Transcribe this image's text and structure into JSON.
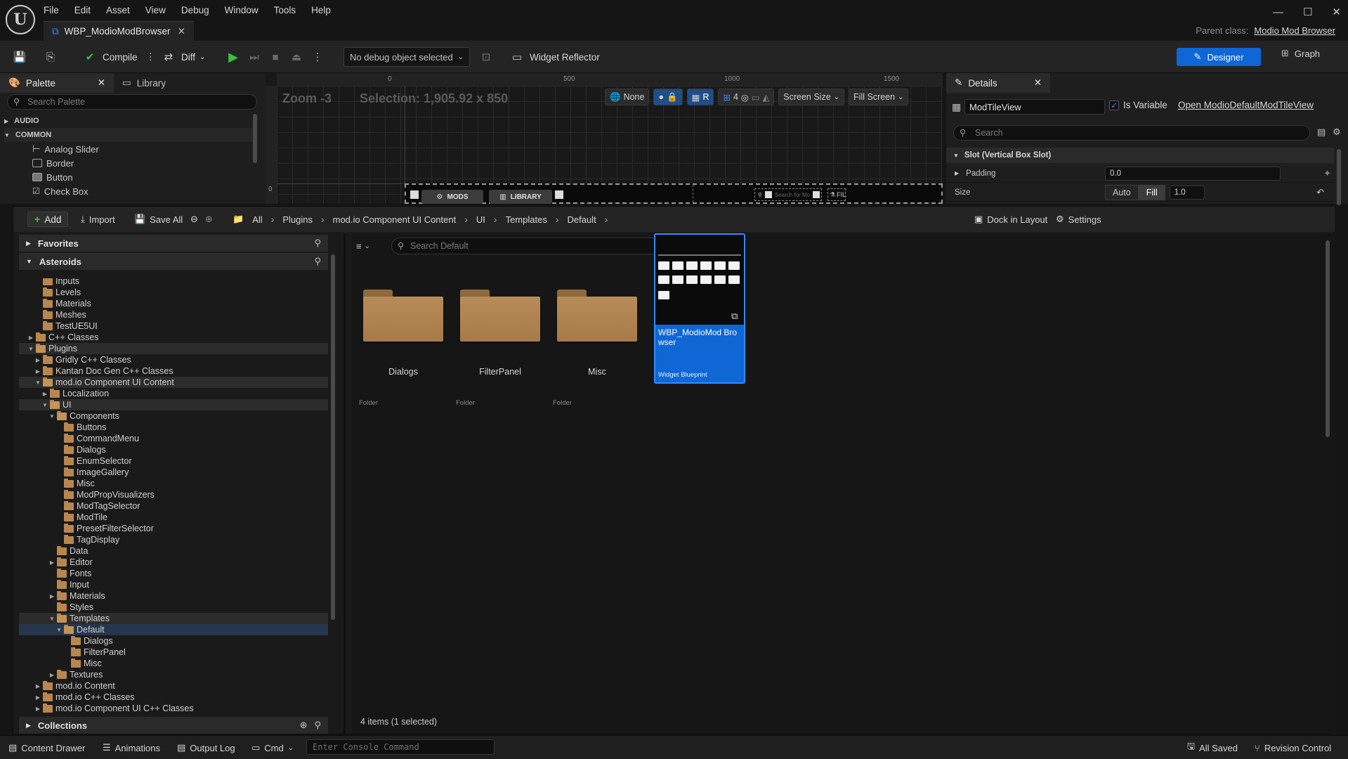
{
  "app": {
    "menu": [
      "File",
      "Edit",
      "Asset",
      "View",
      "Debug",
      "Window",
      "Tools",
      "Help"
    ],
    "document_tab": "WBP_ModioModBrowser",
    "parent_class_label": "Parent class:",
    "parent_class_value": "Modio Mod Browser"
  },
  "toolbar": {
    "compile": "Compile",
    "diff": "Diff",
    "debug_object": "No debug object selected",
    "widget_reflector": "Widget Reflector",
    "designer": "Designer",
    "graph": "Graph"
  },
  "palette": {
    "tab": "Palette",
    "library_tab": "Library",
    "search_placeholder": "Search Palette",
    "categories": [
      "AUDIO",
      "COMMON"
    ],
    "items": [
      "Analog Slider",
      "Border",
      "Button",
      "Check Box"
    ]
  },
  "canvas": {
    "zoom": "Zoom -3",
    "selection": "Selection: 1,905.92 x 850",
    "ruler_marks": [
      "0",
      "500",
      "1000",
      "1500"
    ],
    "ruler_v_mark": "0",
    "none_label": "None",
    "r_label": "R",
    "grid_count": "4",
    "screen_size": "Screen Size",
    "fill_screen": "Fill Screen",
    "preview_tabs": [
      "MODS",
      "LIBRARY"
    ],
    "preview_search": "Search for Mo",
    "preview_filter": "FIL"
  },
  "details": {
    "tab": "Details",
    "widget_name": "ModTileView",
    "is_variable": "Is Variable",
    "open_link": "Open ModioDefaultModTileView",
    "search_placeholder": "Search",
    "section": "Slot (Vertical Box Slot)",
    "padding_label": "Padding",
    "padding_value": "0.0",
    "size_label": "Size",
    "size_auto": "Auto",
    "size_fill": "Fill",
    "size_value": "1.0"
  },
  "content_browser": {
    "add": "Add",
    "import": "Import",
    "save_all": "Save All",
    "breadcrumbs": [
      "All",
      "Plugins",
      "mod.io Component UI Content",
      "UI",
      "Templates",
      "Default"
    ],
    "dock_in_layout": "Dock in Layout",
    "settings": "Settings",
    "favorites": "Favorites",
    "project": "Asteroids",
    "collections": "Collections",
    "tree": [
      {
        "label": "Inputs",
        "depth": 2,
        "arrow": "",
        "state": ""
      },
      {
        "label": "Levels",
        "depth": 2,
        "arrow": "",
        "state": ""
      },
      {
        "label": "Materials",
        "depth": 2,
        "arrow": "",
        "state": ""
      },
      {
        "label": "Meshes",
        "depth": 2,
        "arrow": "",
        "state": ""
      },
      {
        "label": "TestUE5UI",
        "depth": 2,
        "arrow": "",
        "state": ""
      },
      {
        "label": "C++ Classes",
        "depth": 1,
        "arrow": "▶",
        "state": ""
      },
      {
        "label": "Plugins",
        "depth": 1,
        "arrow": "▼",
        "state": "hl"
      },
      {
        "label": "Gridly C++ Classes",
        "depth": 2,
        "arrow": "▶",
        "state": ""
      },
      {
        "label": "Kantan Doc Gen C++ Classes",
        "depth": 2,
        "arrow": "▶",
        "state": ""
      },
      {
        "label": "mod.io Component UI Content",
        "depth": 2,
        "arrow": "▼",
        "state": "hl"
      },
      {
        "label": "Localization",
        "depth": 3,
        "arrow": "▶",
        "state": ""
      },
      {
        "label": "UI",
        "depth": 3,
        "arrow": "▼",
        "state": "hl"
      },
      {
        "label": "Components",
        "depth": 4,
        "arrow": "▼",
        "state": ""
      },
      {
        "label": "Buttons",
        "depth": 5,
        "arrow": "",
        "state": ""
      },
      {
        "label": "CommandMenu",
        "depth": 5,
        "arrow": "",
        "state": ""
      },
      {
        "label": "Dialogs",
        "depth": 5,
        "arrow": "",
        "state": ""
      },
      {
        "label": "EnumSelector",
        "depth": 5,
        "arrow": "",
        "state": ""
      },
      {
        "label": "ImageGallery",
        "depth": 5,
        "arrow": "",
        "state": ""
      },
      {
        "label": "Misc",
        "depth": 5,
        "arrow": "",
        "state": ""
      },
      {
        "label": "ModPropVisualizers",
        "depth": 5,
        "arrow": "",
        "state": ""
      },
      {
        "label": "ModTagSelector",
        "depth": 5,
        "arrow": "",
        "state": ""
      },
      {
        "label": "ModTile",
        "depth": 5,
        "arrow": "",
        "state": ""
      },
      {
        "label": "PresetFilterSelector",
        "depth": 5,
        "arrow": "",
        "state": ""
      },
      {
        "label": "TagDisplay",
        "depth": 5,
        "arrow": "",
        "state": ""
      },
      {
        "label": "Data",
        "depth": 4,
        "arrow": "",
        "state": ""
      },
      {
        "label": "Editor",
        "depth": 4,
        "arrow": "▶",
        "state": ""
      },
      {
        "label": "Fonts",
        "depth": 4,
        "arrow": "",
        "state": ""
      },
      {
        "label": "Input",
        "depth": 4,
        "arrow": "",
        "state": ""
      },
      {
        "label": "Materials",
        "depth": 4,
        "arrow": "▶",
        "state": ""
      },
      {
        "label": "Styles",
        "depth": 4,
        "arrow": "",
        "state": ""
      },
      {
        "label": "Templates",
        "depth": 4,
        "arrow": "▼",
        "state": "hl"
      },
      {
        "label": "Default",
        "depth": 5,
        "arrow": "▼",
        "state": "sel"
      },
      {
        "label": "Dialogs",
        "depth": 6,
        "arrow": "",
        "state": ""
      },
      {
        "label": "FilterPanel",
        "depth": 6,
        "arrow": "",
        "state": ""
      },
      {
        "label": "Misc",
        "depth": 6,
        "arrow": "",
        "state": ""
      },
      {
        "label": "Textures",
        "depth": 4,
        "arrow": "▶",
        "state": ""
      },
      {
        "label": "mod.io Content",
        "depth": 2,
        "arrow": "▶",
        "state": ""
      },
      {
        "label": "mod.io C++ Classes",
        "depth": 2,
        "arrow": "▶",
        "state": ""
      },
      {
        "label": "mod.io Component UI C++ Classes",
        "depth": 2,
        "arrow": "▶",
        "state": ""
      }
    ],
    "search_placeholder": "Search Default",
    "folders": [
      {
        "name": "Dialogs",
        "type": "Folder"
      },
      {
        "name": "FilterPanel",
        "type": "Folder"
      },
      {
        "name": "Misc",
        "type": "Folder"
      }
    ],
    "blueprint": {
      "name": "WBP_ModioMod Browser",
      "type": "Widget Blueprint"
    },
    "item_count": "4 items (1 selected)"
  },
  "statusbar": {
    "content_drawer": "Content Drawer",
    "animations": "Animations",
    "output_log": "Output Log",
    "cmd": "Cmd",
    "console_placeholder": "Enter Console Command",
    "all_saved": "All Saved",
    "revision_control": "Revision Control"
  },
  "colors": {
    "accent": "#0e67d4",
    "folder": "#b8864f",
    "play": "#3bc13b"
  }
}
